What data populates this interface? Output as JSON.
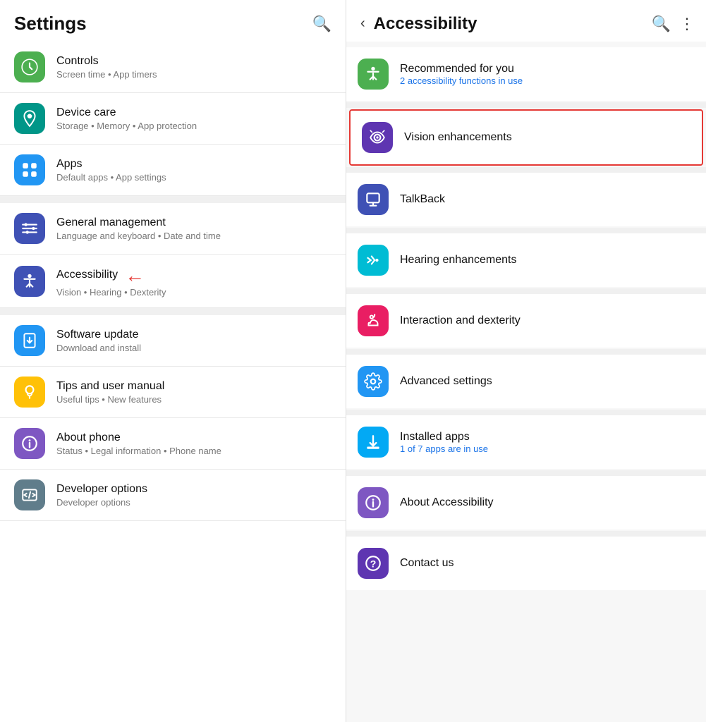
{
  "left": {
    "title": "Settings",
    "search_icon": "🔍",
    "items": [
      {
        "id": "controls",
        "icon": "⏱",
        "icon_bg": "bg-green",
        "icon_unicode": "🕐",
        "title": "Controls",
        "subtitle": "Screen time • App timers",
        "visible_title_only": true
      },
      {
        "id": "device-care",
        "icon": "♻",
        "icon_bg": "bg-teal",
        "title": "Device care",
        "subtitle": "Storage • Memory • App protection"
      },
      {
        "id": "apps",
        "icon": "⋮⋮",
        "icon_bg": "bg-blue",
        "title": "Apps",
        "subtitle": "Default apps • App settings"
      },
      {
        "id": "general-management",
        "icon": "≡",
        "icon_bg": "bg-indigo",
        "title": "General management",
        "subtitle": "Language and keyboard • Date and time"
      },
      {
        "id": "accessibility",
        "icon": "♿",
        "icon_bg": "bg-indigo",
        "title": "Accessibility",
        "subtitle": "Vision • Hearing • Dexterity",
        "has_arrow": true
      },
      {
        "id": "software-update",
        "icon": "↻",
        "icon_bg": "bg-blue",
        "title": "Software update",
        "subtitle": "Download and install"
      },
      {
        "id": "tips",
        "icon": "💡",
        "icon_bg": "bg-amber",
        "title": "Tips and user manual",
        "subtitle": "Useful tips • New features"
      },
      {
        "id": "about-phone",
        "icon": "ℹ",
        "icon_bg": "bg-purple",
        "title": "About phone",
        "subtitle": "Status • Legal information • Phone name"
      },
      {
        "id": "developer-options",
        "icon": "{ }",
        "icon_bg": "bg-blue-grey",
        "title": "Developer options",
        "subtitle": "Developer options"
      }
    ],
    "section_break_after": [
      "apps",
      "accessibility"
    ]
  },
  "right": {
    "title": "Accessibility",
    "back_icon": "‹",
    "search_icon": "🔍",
    "more_icon": "⋮",
    "items": [
      {
        "id": "recommended",
        "icon": "♿",
        "icon_bg": "bg-green",
        "title": "Recommended for you",
        "subtitle": "2 accessibility functions in use",
        "subtitle_color": "blue"
      },
      {
        "id": "vision-enhancements",
        "icon": "🔍",
        "icon_bg": "bg-deep-purple",
        "title": "Vision enhancements",
        "subtitle": "",
        "highlighted": true
      },
      {
        "id": "talkback",
        "icon": "▣",
        "icon_bg": "bg-indigo",
        "title": "TalkBack",
        "subtitle": ""
      },
      {
        "id": "hearing-enhancements",
        "icon": "🔊",
        "icon_bg": "bg-cyan",
        "title": "Hearing enhancements",
        "subtitle": ""
      },
      {
        "id": "interaction-dexterity",
        "icon": "✋",
        "icon_bg": "bg-pink",
        "title": "Interaction and dexterity",
        "subtitle": ""
      },
      {
        "id": "advanced-settings",
        "icon": "⚙",
        "icon_bg": "bg-blue",
        "title": "Advanced settings",
        "subtitle": ""
      },
      {
        "id": "installed-apps",
        "icon": "⬇",
        "icon_bg": "bg-light-blue",
        "title": "Installed apps",
        "subtitle": "1 of 7 apps are in use",
        "subtitle_color": "blue"
      },
      {
        "id": "about-accessibility",
        "icon": "ℹ",
        "icon_bg": "bg-purple",
        "title": "About Accessibility",
        "subtitle": ""
      },
      {
        "id": "contact-us",
        "icon": "?",
        "icon_bg": "bg-deep-purple",
        "title": "Contact us",
        "subtitle": ""
      }
    ]
  }
}
